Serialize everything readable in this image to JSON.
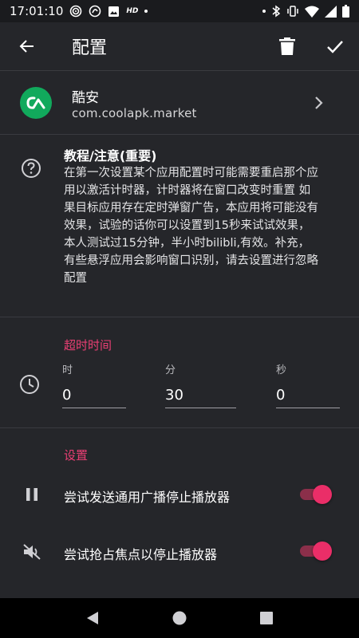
{
  "status_bar": {
    "time": "17:01:10",
    "hd_label": "HD",
    "icons": [
      "hotspot-icon",
      "netease-icon",
      "image-icon",
      "hd-icon",
      "dot-icon",
      "dot-icon",
      "bluetooth-icon",
      "vibrate-icon",
      "wifi-icon",
      "signal-icon",
      "battery-icon"
    ]
  },
  "app_bar": {
    "title": "配置",
    "icons": {
      "back": "arrow-back-icon",
      "delete": "trash-icon",
      "confirm": "check-icon"
    }
  },
  "app_info": {
    "name": "酷安",
    "package": "com.coolapk.market",
    "icon_color": "#11a95c"
  },
  "tutorial": {
    "title": "教程/注意(重要)",
    "body": "在第一次设置某个应用配置时可能需要重启那个应用以激活计时器，计时器将在窗口改变时重置 如果目标应用存在定时弹窗广告，本应用将可能没有效果，试验的话你可以设置到15秒来试试效果，本人测试过15分钟，半小时bilibli,有效。补充，有些悬浮应用会影响窗口识别，请去设置进行忽略配置"
  },
  "timeout": {
    "header": "超时时间",
    "hours": {
      "label": "时",
      "value": "0"
    },
    "minutes": {
      "label": "分",
      "value": "30"
    },
    "seconds": {
      "label": "秒",
      "value": "0"
    }
  },
  "settings": {
    "header": "设置",
    "items": [
      {
        "label": "尝试发送通用广播停止播放器",
        "icon": "pause-icon",
        "enabled": true
      },
      {
        "label": "尝试抢占焦点以停止播放器",
        "icon": "volume-off-icon",
        "enabled": true
      }
    ]
  },
  "colors": {
    "accent": "#ea3f74",
    "background": "#25262a",
    "switch_thumb": "#ea2e68"
  }
}
